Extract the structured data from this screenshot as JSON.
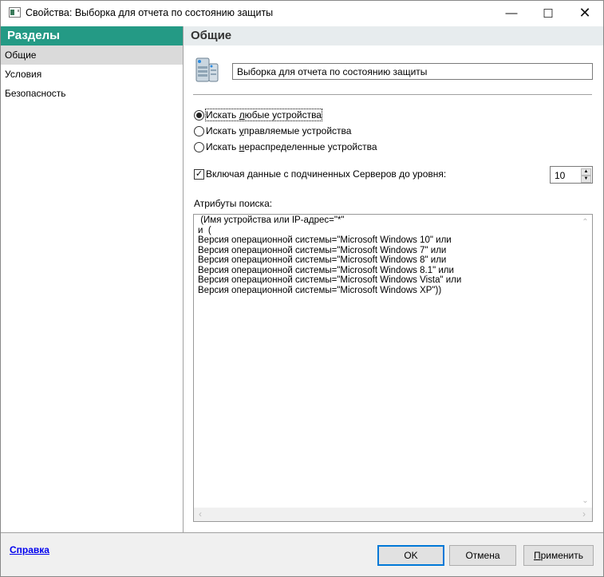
{
  "window": {
    "title": "Свойства: Выборка для отчета по состоянию защиты"
  },
  "sidebar": {
    "header": "Разделы",
    "items": [
      {
        "label": "Общие",
        "selected": true
      },
      {
        "label": "Условия"
      },
      {
        "label": "Безопасность"
      }
    ]
  },
  "main": {
    "header": "Общие",
    "name_value": "Выборка для отчета по состоянию защиты",
    "radios": [
      {
        "pre": "Искать ",
        "accel": "л",
        "post": "юбые устройства",
        "checked": true
      },
      {
        "pre": "Искать ",
        "accel": "у",
        "post": "правляемые устройства",
        "checked": false
      },
      {
        "pre": "Искать ",
        "accel": "н",
        "post": "ераспределенные устройства",
        "checked": false
      }
    ],
    "include_sub": {
      "label": "Включая данные с подчиненных Серверов до уровня:",
      "checked": true,
      "level": "10"
    },
    "search_attr_label": "Атрибуты поиска:",
    "search_attr_text": " (Имя устройства или IP-адрес=\"*\"\nи  (\nВерсия операционной системы=\"Microsoft Windows 10\" или\nВерсия операционной системы=\"Microsoft Windows 7\" или\nВерсия операционной системы=\"Microsoft Windows 8\" или\nВерсия операционной системы=\"Microsoft Windows 8.1\" или\nВерсия операционной системы=\"Microsoft Windows Vista\" или\nВерсия операционной системы=\"Microsoft Windows XP\"))"
  },
  "footer": {
    "help": "Справка",
    "ok": "OK",
    "cancel": "Отмена",
    "apply_accel": "П",
    "apply_rest": "рименить"
  }
}
